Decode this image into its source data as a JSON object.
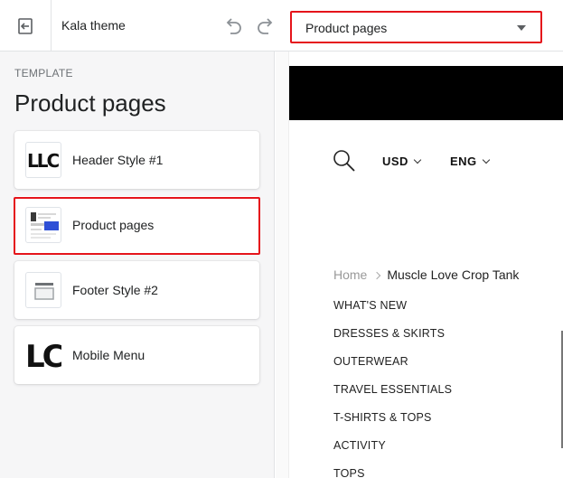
{
  "topbar": {
    "theme_name": "Kala theme",
    "template_select_value": "Product pages",
    "icons": [
      "exit-icon",
      "undo-icon",
      "redo-icon",
      "chevron-down-icon"
    ]
  },
  "sidebar": {
    "eyebrow": "TEMPLATE",
    "title": "Product pages",
    "sections": [
      {
        "label": "Header Style #1",
        "thumb": "LLC"
      },
      {
        "label": "Product pages"
      },
      {
        "label": "Footer Style #2"
      },
      {
        "label": "Mobile Menu",
        "thumb": "LC"
      }
    ]
  },
  "preview": {
    "currency": "USD",
    "language": "ENG",
    "breadcrumb": {
      "home": "Home",
      "current": "Muscle Love Crop Tank"
    },
    "menu": [
      "WHAT'S NEW",
      "DRESSES & SKIRTS",
      "OUTERWEAR",
      "TRAVEL ESSENTIALS",
      "T-SHIRTS & TOPS",
      "ACTIVITY",
      "TOPS"
    ]
  },
  "colors": {
    "highlight": "#e5141b",
    "sidebar_bg": "#f6f6f7",
    "banner": "#000000"
  }
}
